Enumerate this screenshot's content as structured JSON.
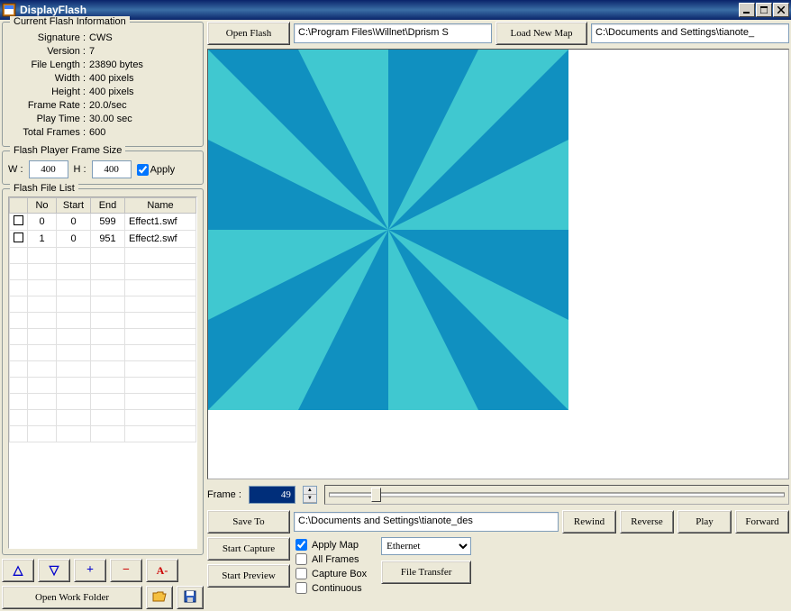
{
  "window": {
    "title": "DisplayFlash"
  },
  "info": {
    "group_title": "Current Flash Information",
    "signature_label": "Signature :",
    "signature": "CWS",
    "version_label": "Version :",
    "version": "7",
    "filelength_label": "File Length :",
    "filelength": "23890 bytes",
    "width_label": "Width :",
    "width": "400 pixels",
    "height_label": "Height :",
    "height": "400 pixels",
    "framerate_label": "Frame Rate :",
    "framerate": "20.0/sec",
    "playtime_label": "Play Time :",
    "playtime": "30.00 sec",
    "totalframes_label": "Total Frames :",
    "totalframes": "600"
  },
  "fps": {
    "group_title": "Flash Player Frame Size",
    "w_label": "W :",
    "w_val": "400",
    "h_label": "H :",
    "h_val": "400",
    "apply_label": "Apply"
  },
  "filelist": {
    "group_title": "Flash File List",
    "cols": {
      "no": "No",
      "start": "Start",
      "end": "End",
      "name": "Name"
    },
    "rows": [
      {
        "no": "0",
        "start": "0",
        "end": "599",
        "name": "Effect1.swf"
      },
      {
        "no": "1",
        "start": "0",
        "end": "951",
        "name": "Effect2.swf"
      }
    ]
  },
  "leftbtns": {
    "up": "△",
    "down": "▽",
    "plus": "+",
    "minus": "−",
    "aminus": "A-",
    "open_work": "Open Work Folder"
  },
  "top": {
    "open_flash": "Open Flash",
    "flash_path": "C:\\Program Files\\Willnet\\Dprism S",
    "load_map": "Load New Map",
    "map_path": "C:\\Documents and Settings\\tianote_"
  },
  "frame": {
    "label": "Frame :",
    "value": "49"
  },
  "save": {
    "save_to": "Save To",
    "path": "C:\\Documents and Settings\\tianote_des",
    "rewind": "Rewind",
    "reverse": "Reverse",
    "play": "Play",
    "forward": "Forward"
  },
  "bottom": {
    "start_capture": "Start Capture",
    "start_preview": "Start Preview",
    "apply_map": "Apply Map",
    "all_frames": "All Frames",
    "capture_box": "Capture Box",
    "continuous": "Continuous",
    "transport": "Ethernet",
    "file_transfer": "File Transfer"
  }
}
